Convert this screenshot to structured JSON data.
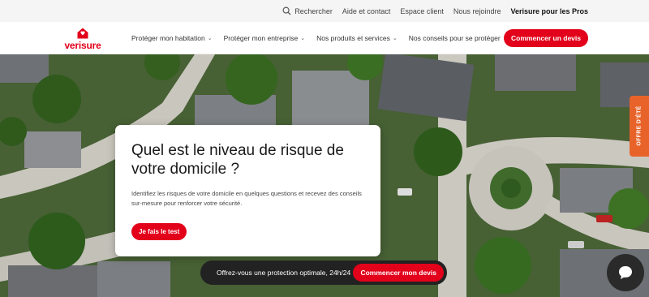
{
  "topbar": {
    "search_label": "Rechercher",
    "links": [
      "Aide et contact",
      "Espace client",
      "Nous rejoindre"
    ],
    "pros_label": "Verisure pour les Pros"
  },
  "brand": {
    "name": "verisure",
    "color": "#e2001a"
  },
  "nav": {
    "items": [
      {
        "label": "Protéger mon habitation"
      },
      {
        "label": "Protéger mon entreprise"
      },
      {
        "label": "Nos produits et services"
      },
      {
        "label": "Nos conseils pour se protéger"
      }
    ],
    "cta_label": "Commencer un devis"
  },
  "hero": {
    "title": "Quel est le niveau de risque de votre domicile ?",
    "description": "Identifiez les risques de votre domicile en quelques questions et recevez des conseils sur-mesure pour renforcer votre sécurité.",
    "button_label": "Je fais le test"
  },
  "bottom_bar": {
    "text": "Offrez-vous une protection optimale, 24h/24",
    "button_label": "Commencer mon devis"
  },
  "side_tab": {
    "label": "OFFRE D'ÉTÉ",
    "color": "#e8632a"
  },
  "icons": [
    "search-icon",
    "chevron-down-icon",
    "house-logo-icon",
    "chat-icon"
  ]
}
